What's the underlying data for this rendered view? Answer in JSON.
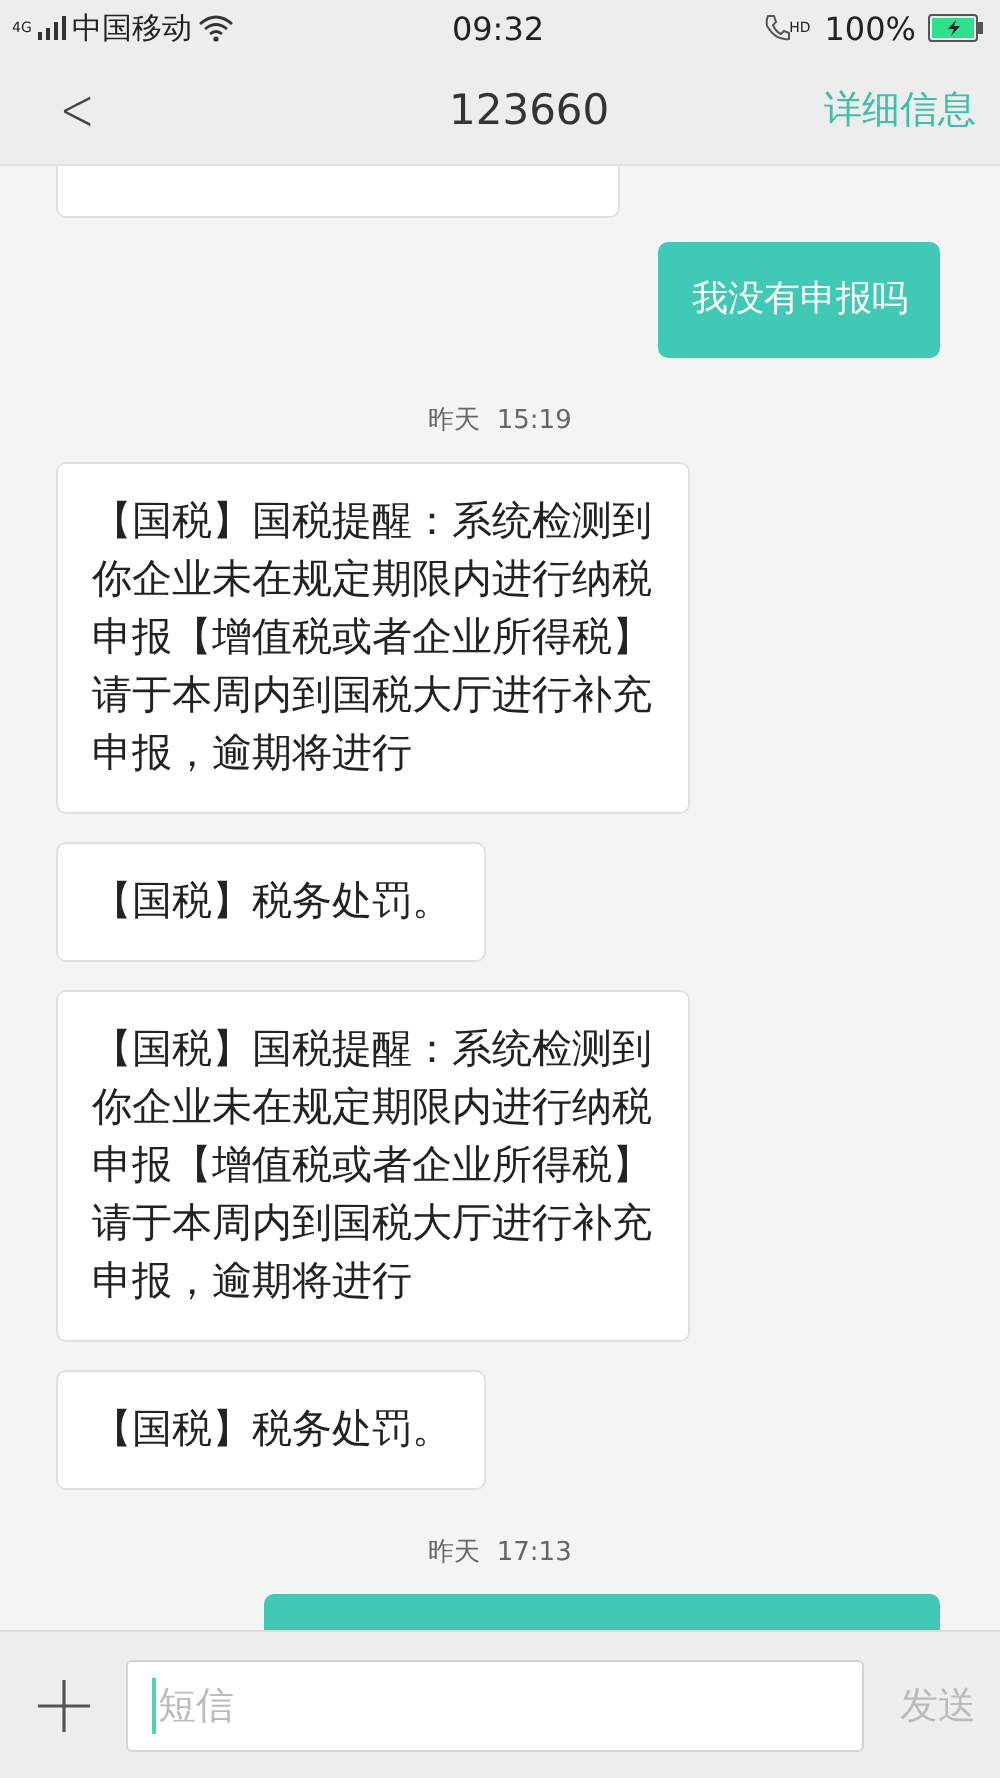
{
  "status_bar": {
    "network": "4G",
    "carrier": "中国移动",
    "time": "09:32",
    "call_badge": "HD",
    "battery": "100%"
  },
  "header": {
    "back": "<",
    "title": "123660",
    "action": "详细信息"
  },
  "messages": [
    {
      "kind": "incoming-cut"
    },
    {
      "kind": "outgoing",
      "text": "我没有申报吗"
    },
    {
      "kind": "time",
      "text": "昨天  15:19"
    },
    {
      "kind": "incoming",
      "text": "【国税】国税提醒：系统检测到你企业未在规定期限内进行纳税申报【增值税或者企业所得税】请于本周内到国税大厅进行补充申报，逾期将进行"
    },
    {
      "kind": "incoming",
      "text": "【国税】税务处罚。"
    },
    {
      "kind": "incoming",
      "text": "【国税】国税提醒：系统检测到你企业未在规定期限内进行纳税申报【增值税或者企业所得税】请于本周内到国税大厅进行补充申报，逾期将进行"
    },
    {
      "kind": "incoming",
      "text": "【国税】税务处罚。"
    },
    {
      "kind": "time",
      "text": "昨天  17:13"
    },
    {
      "kind": "outgoing-cut"
    }
  ],
  "composer": {
    "placeholder": "短信",
    "send": "发送"
  }
}
